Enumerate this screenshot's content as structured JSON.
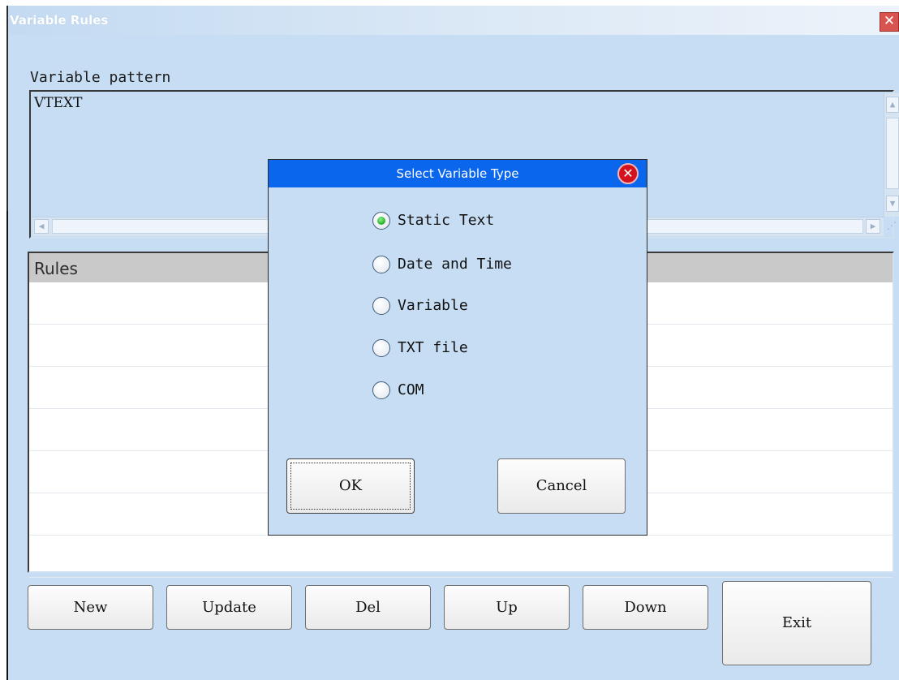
{
  "window": {
    "title": "Variable Rules",
    "close_icon": "close-icon"
  },
  "pattern": {
    "label": "Variable pattern",
    "value": "VTEXT"
  },
  "rules": {
    "header": "Rules",
    "rows": [
      "",
      "",
      "",
      "",
      "",
      "",
      ""
    ]
  },
  "buttons": {
    "new": "New",
    "update": "Update",
    "del": "Del",
    "up": "Up",
    "down": "Down",
    "exit": "Exit"
  },
  "dialog": {
    "title": "Select Variable Type",
    "options": [
      {
        "label": "Static Text",
        "checked": true
      },
      {
        "label": "Date and Time",
        "checked": false
      },
      {
        "label": "Variable",
        "checked": false
      },
      {
        "label": "TXT file",
        "checked": false
      },
      {
        "label": "COM",
        "checked": false
      }
    ],
    "ok": "OK",
    "cancel": "Cancel"
  },
  "colors": {
    "window_bg": "#c6ddf4",
    "dialog_title_bg": "#0a66ec",
    "dialog_close": "#d3131e",
    "window_close": "#d9534f",
    "rules_header_bg": "#c9c9c9"
  }
}
